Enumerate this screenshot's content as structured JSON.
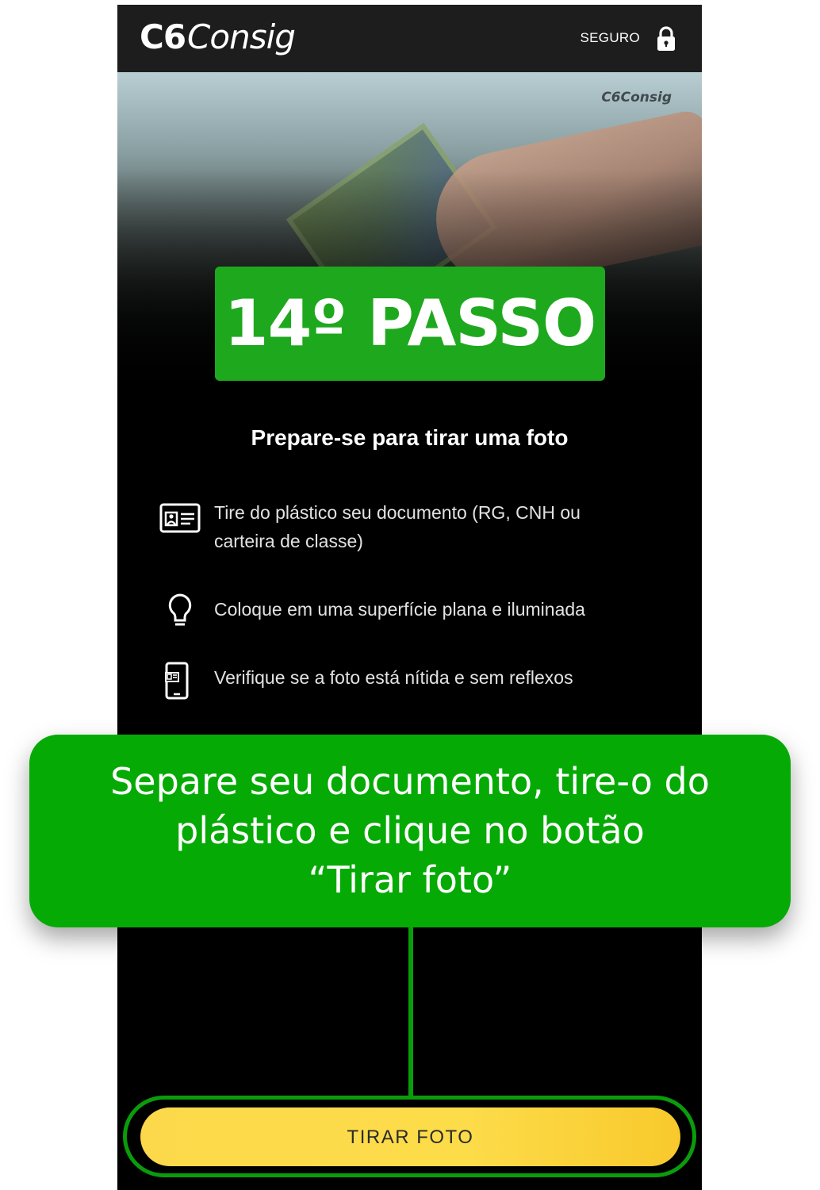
{
  "header": {
    "logo_c6": "C6",
    "logo_consig": "Consig",
    "secure_label": "SEGURO"
  },
  "hero": {
    "watermark": "C6Consig",
    "step_label": "14º PASSO"
  },
  "main": {
    "subtitle": "Prepare-se para tirar uma foto",
    "instructions": [
      {
        "icon": "id-card-icon",
        "text": "Tire do plástico seu documento (RG, CNH ou carteira de classe)"
      },
      {
        "icon": "lightbulb-icon",
        "text": "Coloque em uma superfície plana e iluminada"
      },
      {
        "icon": "phone-id-icon",
        "text": "Verifique se a foto está nítida e sem reflexos"
      }
    ]
  },
  "callout": {
    "lines": [
      "Separe seu documento, tire-o do",
      "plástico e clique no botão",
      "“Tirar foto”"
    ]
  },
  "cta": {
    "label": "TIRAR FOTO"
  },
  "colors": {
    "header_bg": "#1d1d1d",
    "badge_green": "#1ea81e",
    "callout_green": "#05aa05",
    "button_yellow": "#fcd94a"
  }
}
